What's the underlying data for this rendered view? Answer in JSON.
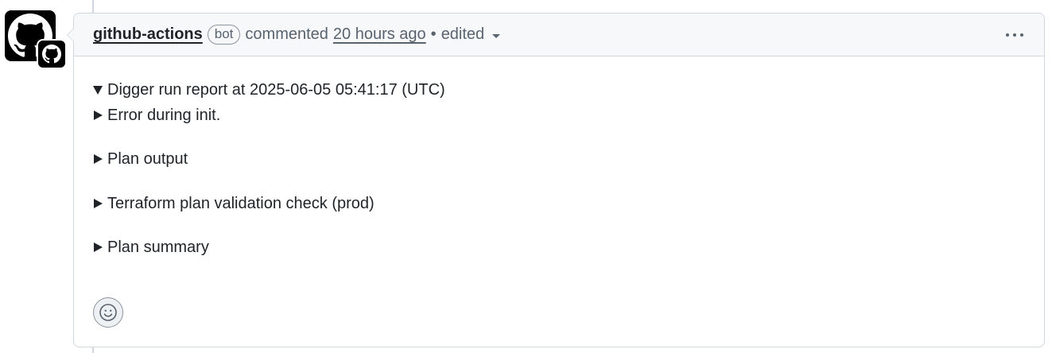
{
  "comment": {
    "author": "github-actions",
    "badge": "bot",
    "action": "commented",
    "time": "20 hours ago",
    "separator": "•",
    "edited": "edited",
    "icons": {
      "avatar": "github-mark-icon",
      "avatar_badge": "github-app-badge-icon",
      "more": "kebab-horizontal-icon",
      "edited_menu": "caret-down-icon",
      "reaction": "smiley-icon"
    },
    "body": {
      "items": [
        {
          "label": "Digger run report at 2025-06-05 05:41:17 (UTC)",
          "expanded": true
        },
        {
          "label": "Error during init.",
          "expanded": false
        },
        {
          "label": "Plan output",
          "expanded": false
        },
        {
          "label": "Terraform plan validation check (prod)",
          "expanded": false
        },
        {
          "label": "Plan summary",
          "expanded": false
        }
      ]
    }
  }
}
